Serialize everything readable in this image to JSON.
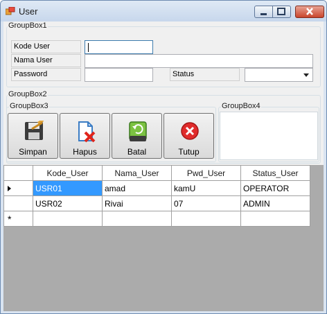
{
  "window": {
    "title": "User"
  },
  "groupbox1": {
    "title": "GroupBox1",
    "kode_user_label": "Kode User",
    "nama_user_label": "Nama User",
    "password_label": "Password",
    "status_label": "Status",
    "kode_user_value": "",
    "nama_user_value": "",
    "password_value": "",
    "status_value": ""
  },
  "groupbox2": {
    "title": "GroupBox2"
  },
  "groupbox3": {
    "title": "GroupBox3",
    "buttons": {
      "simpan": "Simpan",
      "hapus": "Hapus",
      "batal": "Batal",
      "tutup": "Tutup"
    }
  },
  "groupbox4": {
    "title": "GroupBox4"
  },
  "grid": {
    "columns": [
      "Kode_User",
      "Nama_User",
      "Pwd_User",
      "Status_User"
    ],
    "rows": [
      [
        "USR01",
        "amad",
        "kamU",
        "OPERATOR"
      ],
      [
        "USR02",
        "Rivai",
        "07",
        "ADMIN"
      ]
    ],
    "new_row_marker": "*"
  },
  "icons": {
    "window": "user-form-icon",
    "simpan": "floppy-disk-icon",
    "hapus": "delete-document-icon",
    "batal": "undo-drive-icon",
    "tutup": "close-circle-icon"
  }
}
